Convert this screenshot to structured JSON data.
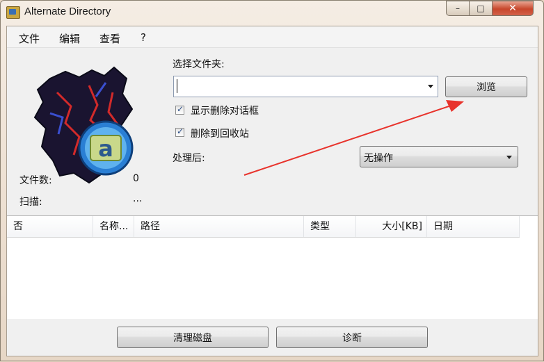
{
  "window": {
    "title": "Alternate Directory",
    "controls": {
      "minimize": "–",
      "maximize": "□",
      "close": "✕"
    }
  },
  "menu": [
    "文件",
    "编辑",
    "查看",
    "?"
  ],
  "folder": {
    "label": "选择文件夹:",
    "value": "",
    "browse_button": "浏览"
  },
  "options": {
    "show_delete_dialog": {
      "label": "显示删除对话框",
      "checked": true
    },
    "delete_to_recycle": {
      "label": "删除到回收站",
      "checked": true
    }
  },
  "after": {
    "label": "处理后:",
    "selected": "无操作"
  },
  "stats": {
    "file_count_label": "文件数:",
    "file_count_value": "0",
    "scan_label": "扫描:",
    "scan_value": "..."
  },
  "table": {
    "columns": [
      "否",
      "名称...",
      "路径",
      "类型",
      "大小[KB]",
      "日期"
    ],
    "rows": []
  },
  "actions": {
    "clean_disk": "清理磁盘",
    "diagnose": "诊断"
  },
  "colors": {
    "annotation_arrow": "#e8332c",
    "close_button": "#c7472c"
  }
}
